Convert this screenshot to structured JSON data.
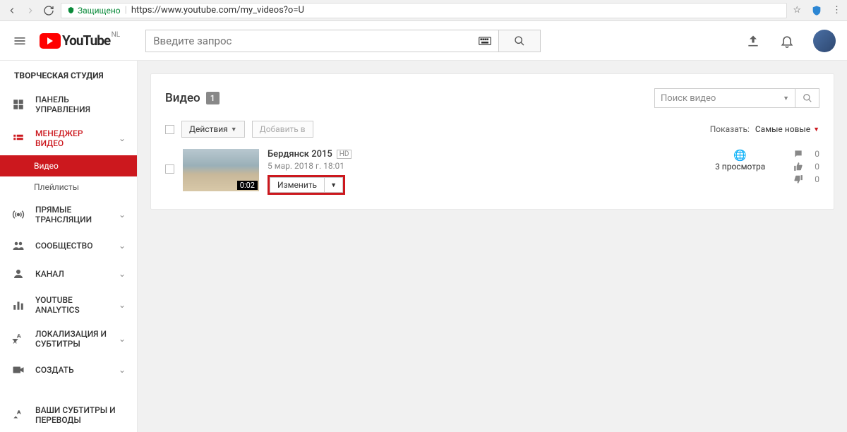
{
  "browser": {
    "secure_label": "Защищено",
    "url_display": "https://www.youtube.com/my_videos?o=U"
  },
  "header": {
    "logo_text": "YouTube",
    "country": "NL",
    "search_placeholder": "Введите запрос"
  },
  "sidebar": {
    "studio_title": "ТВОРЧЕСКАЯ СТУДИЯ",
    "items": [
      {
        "label": "ПАНЕЛЬ УПРАВЛЕНИЯ"
      },
      {
        "label": "МЕНЕДЖЕР ВИДЕО"
      },
      {
        "label": "ПРЯМЫЕ ТРАНСЛЯЦИИ"
      },
      {
        "label": "СООБЩЕСТВО"
      },
      {
        "label": "КАНАЛ"
      },
      {
        "label": "YOUTUBE ANALYTICS"
      },
      {
        "label": "ЛОКАЛИЗАЦИЯ И СУБТИТРЫ"
      },
      {
        "label": "СОЗДАТЬ"
      },
      {
        "label": "ВАШИ СУБТИТРЫ И ПЕРЕВОДЫ"
      }
    ],
    "sub_items": [
      {
        "label": "Видео"
      },
      {
        "label": "Плейлисты"
      }
    ]
  },
  "main": {
    "title": "Видео",
    "count": "1",
    "search_placeholder": "Поиск видео",
    "actions_label": "Действия",
    "addto_label": "Добавить в",
    "show_label": "Показать:",
    "sort_label": "Самые новые",
    "video": {
      "title": "Бердянск 2015",
      "hd": "HD",
      "date": "5 мар. 2018 г. 18:01",
      "duration": "0:02",
      "edit_label": "Изменить",
      "views": "3 просмотра",
      "comments": "0",
      "likes": "0",
      "dislikes": "0"
    }
  }
}
